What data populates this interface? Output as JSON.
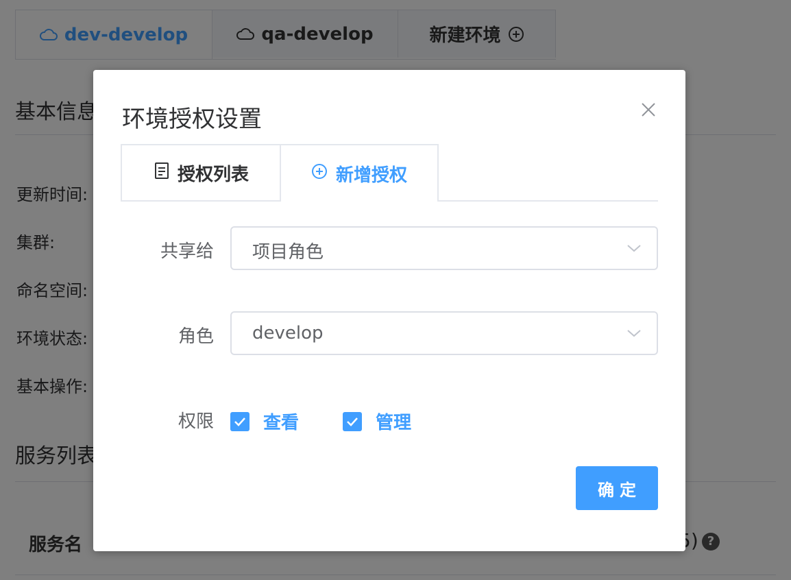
{
  "background": {
    "env_tabs": [
      {
        "label": "dev-develop",
        "icon": "cloud-icon",
        "active": true
      },
      {
        "label": "qa-develop",
        "icon": "cloud-icon",
        "active": false
      },
      {
        "label": "新建环境",
        "icon": "plus-circle-icon",
        "active": false
      }
    ],
    "section_basic": "基本信息",
    "info_labels": [
      "更新时间:",
      "集群:",
      "命名空间:",
      "环境状态:",
      "基本操作:"
    ],
    "section_services": "服务列表",
    "service_name_header": "服务名",
    "right_fragment": "5)"
  },
  "dialog": {
    "title": "环境授权设置",
    "tabs": [
      {
        "label": "授权列表",
        "icon": "document-icon",
        "active": false
      },
      {
        "label": "新增授权",
        "icon": "plus-circle-icon",
        "active": true
      }
    ],
    "form": {
      "share_label": "共享给",
      "share_value": "项目角色",
      "role_label": "角色",
      "role_value": "develop",
      "permission_label": "权限",
      "permissions": [
        {
          "label": "查看",
          "checked": true
        },
        {
          "label": "管理",
          "checked": true
        }
      ]
    },
    "confirm_label": "确定"
  },
  "colors": {
    "accent": "#409eff",
    "overlay": "rgba(0,0,0,0.5)"
  }
}
